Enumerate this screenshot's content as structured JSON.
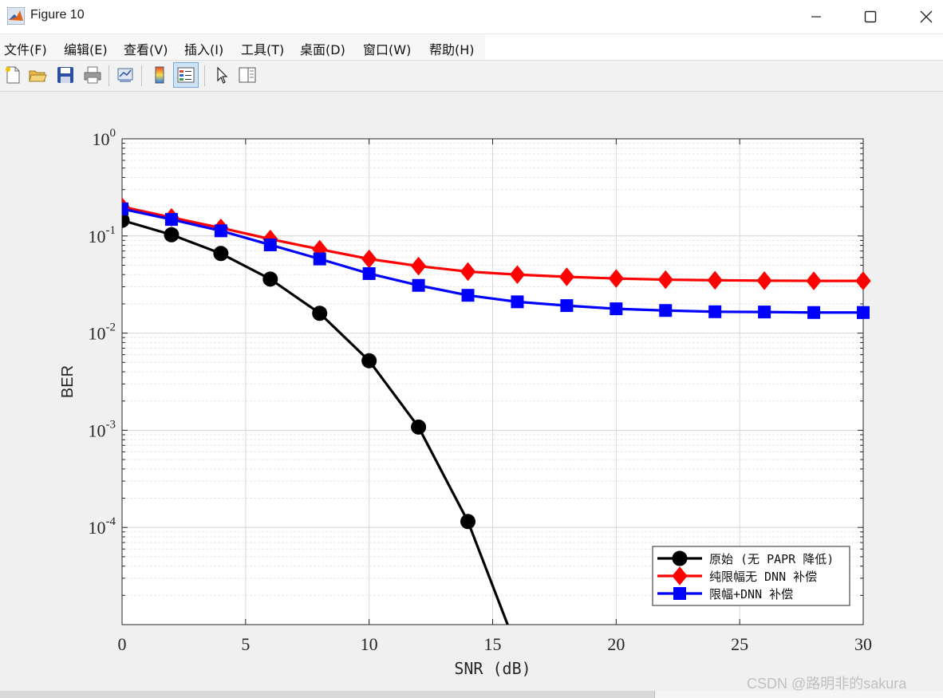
{
  "window": {
    "title": "Figure 10",
    "minimize_icon": "minimize-icon",
    "maximize_icon": "maximize-icon",
    "close_icon": "close-icon"
  },
  "menu": [
    "文件(F)",
    "编辑(E)",
    "查看(V)",
    "插入(I)",
    "工具(T)",
    "桌面(D)",
    "窗口(W)",
    "帮助(H)"
  ],
  "toolbar": {
    "icons": [
      "new-figure-icon",
      "open-file-icon",
      "save-icon",
      "print-icon",
      "link-plot-icon",
      "colorbar-icon",
      "legend-icon",
      "pointer-icon",
      "property-editor-icon"
    ]
  },
  "colors": {
    "series1": "#000000",
    "series2": "#ff0000",
    "series3": "#0000ff"
  },
  "watermark": "CSDN @路明非的sakura",
  "chart_data": {
    "type": "line",
    "xlabel": "SNR (dB)",
    "ylabel": "BER",
    "xlim": [
      0,
      30
    ],
    "ylim": [
      1e-05,
      1
    ],
    "yscale": "log",
    "xticks": [
      0,
      5,
      10,
      15,
      20,
      25,
      30
    ],
    "yticks": [
      {
        "value": 1,
        "base": "10",
        "exp": "0"
      },
      {
        "value": 0.1,
        "base": "10",
        "exp": "-1"
      },
      {
        "value": 0.01,
        "base": "10",
        "exp": "-2"
      },
      {
        "value": 0.001,
        "base": "10",
        "exp": "-3"
      },
      {
        "value": 0.0001,
        "base": "10",
        "exp": "-4"
      }
    ],
    "grid": true,
    "legend_position": "bottom-right",
    "series": [
      {
        "name": "原始 (无 PAPR 降低)",
        "color": "#000000",
        "marker": "circle",
        "x": [
          0,
          2,
          4,
          6,
          8,
          10,
          12,
          14,
          16
        ],
        "values": [
          0.145,
          0.103,
          0.066,
          0.036,
          0.016,
          0.0052,
          0.00108,
          0.000115,
          5.5e-06
        ]
      },
      {
        "name": "纯限幅无 DNN 补偿",
        "color": "#ff0000",
        "marker": "diamond",
        "x": [
          0,
          2,
          4,
          6,
          8,
          10,
          12,
          14,
          16,
          18,
          20,
          22,
          24,
          26,
          28,
          30
        ],
        "values": [
          0.2,
          0.155,
          0.121,
          0.093,
          0.073,
          0.058,
          0.049,
          0.043,
          0.04,
          0.038,
          0.0365,
          0.0355,
          0.035,
          0.0347,
          0.0345,
          0.0345
        ]
      },
      {
        "name": "限幅+DNN 补偿",
        "color": "#0000ff",
        "marker": "square",
        "x": [
          0,
          2,
          4,
          6,
          8,
          10,
          12,
          14,
          16,
          18,
          20,
          22,
          24,
          26,
          28,
          30
        ],
        "values": [
          0.19,
          0.148,
          0.113,
          0.081,
          0.058,
          0.041,
          0.031,
          0.0245,
          0.021,
          0.0192,
          0.0178,
          0.0171,
          0.0166,
          0.0165,
          0.0163,
          0.0163
        ]
      }
    ]
  }
}
